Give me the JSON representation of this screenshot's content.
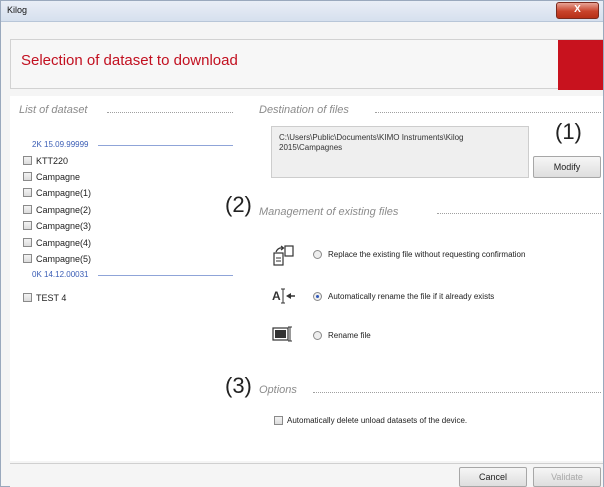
{
  "window": {
    "title": "Kilog",
    "close_label": "X"
  },
  "header": {
    "title": "Selection of dataset to download"
  },
  "dataset_list": {
    "title": "List of dataset",
    "devices": [
      {
        "label": "2K 15.09.99999",
        "items": [
          "KTT220",
          "Campagne",
          "Campagne(1)",
          "Campagne(2)",
          "Campagne(3)",
          "Campagne(4)",
          "Campagne(5)"
        ]
      },
      {
        "label": "0K 14.12.00031",
        "items": [
          "TEST 4"
        ]
      }
    ]
  },
  "destination": {
    "title": "Destination of files",
    "path": "C:\\Users\\Public\\Documents\\KIMO Instruments\\Kilog 2015\\Campagnes",
    "modify_label": "Modify",
    "marker": "(1)"
  },
  "management": {
    "title": "Management of existing files",
    "marker": "(2)",
    "options": [
      {
        "label": "Replace the existing file without requesting confirmation",
        "selected": false,
        "icon": "replace-file-icon"
      },
      {
        "label": "Automatically rename the file if it already exists",
        "selected": true,
        "icon": "auto-rename-icon"
      },
      {
        "label": "Rename file",
        "selected": false,
        "icon": "rename-file-icon"
      }
    ]
  },
  "options": {
    "title": "Options",
    "marker": "(3)",
    "delete_label": "Automatically delete unload datasets of the device.",
    "delete_checked": false
  },
  "footer": {
    "cancel_label": "Cancel",
    "validate_label": "Validate"
  }
}
